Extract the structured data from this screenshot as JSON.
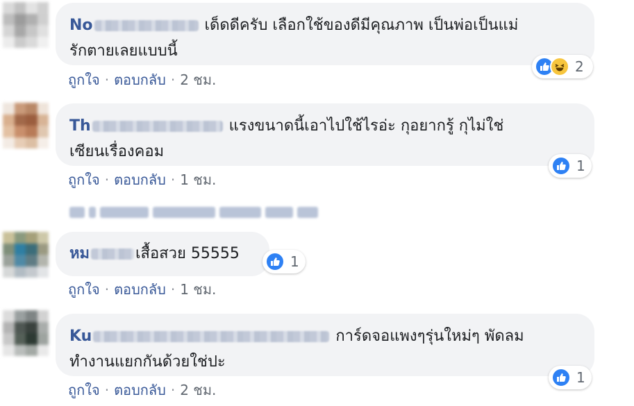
{
  "comments": [
    {
      "author_visible": "No",
      "text_line1": "เด็ดดีครับ เลือกใช้ของดีมีคุณภาพ เป็นพ่อเป็นแม่",
      "text_line2": "รักตายเลยแบบนี้",
      "like_label": "ถูกใจ",
      "reply_label": "ตอบกลับ",
      "time": "2 ชม.",
      "reaction_count": "2",
      "reaction_icons": [
        "like-icon",
        "haha-icon"
      ]
    },
    {
      "author_visible": "Th",
      "text_line1": "แรงขนาดนี้เอาไปใช้ไรอ่ะ กุอยากรู้ กุไม่ใช่",
      "text_line2": "เซียนเรื่องคอม",
      "like_label": "ถูกใจ",
      "reply_label": "ตอบกลับ",
      "time": "1 ชม.",
      "reaction_count": "1",
      "reaction_icons": [
        "like-icon"
      ]
    },
    {
      "author_visible": "หม",
      "text_line1": "เสื้อสวย 55555",
      "like_label": "ถูกใจ",
      "reply_label": "ตอบกลับ",
      "time": "1 ชม.",
      "reaction_count": "1",
      "reaction_icons": [
        "like-icon"
      ]
    },
    {
      "author_visible": "Ku",
      "text_line1": "การ์ดจอแพงๆรุ่นใหม่ๆ พัดลม",
      "text_line2": "ทำงานแยกกันด้วยใช่ปะ",
      "like_label": "ถูกใจ",
      "reply_label": "ตอบกลับ",
      "time": "2 ชม.",
      "reaction_count": "1",
      "reaction_icons": [
        "like-icon"
      ]
    }
  ],
  "colors": {
    "author": "#385898",
    "bubble_bg": "#f2f3f5",
    "meta_text": "#606770",
    "like_blue": "#2e81f4",
    "haha_yellow": "#f7c53d"
  }
}
